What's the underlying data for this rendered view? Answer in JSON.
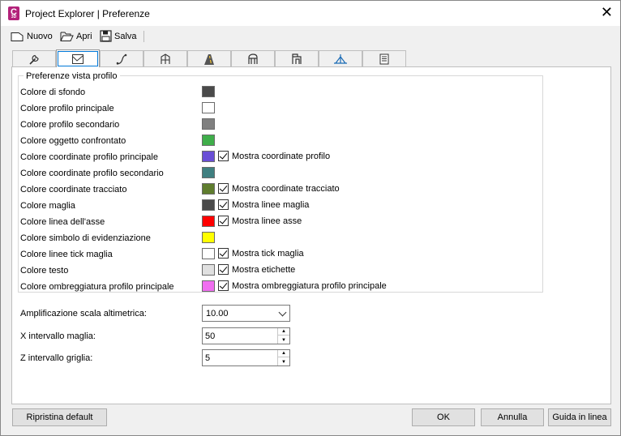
{
  "window": {
    "title": "Project Explorer | Preferenze",
    "app_icon_letter": "C",
    "app_icon_sub": "3D"
  },
  "toolbar": {
    "new_label": "Nuovo",
    "open_label": "Apri",
    "save_label": "Salva"
  },
  "tabs": [
    {
      "icon": "wrench-icon"
    },
    {
      "icon": "profile-view-icon",
      "active": true
    },
    {
      "icon": "alignment-icon"
    },
    {
      "icon": "corridor-icon"
    },
    {
      "icon": "road-icon"
    },
    {
      "icon": "pipe-network-icon"
    },
    {
      "icon": "pressure-network-icon"
    },
    {
      "icon": "survey-icon"
    },
    {
      "icon": "report-icon"
    }
  ],
  "group": {
    "title": "Preferenze vista profilo",
    "rows": [
      {
        "label": "Colore di sfondo",
        "color": "#4a4a4a"
      },
      {
        "label": "Colore profilo principale",
        "color": "#ffffff"
      },
      {
        "label": "Colore profilo secondario",
        "color": "#808080"
      },
      {
        "label": "Colore oggetto confrontato",
        "color": "#3fae4a"
      },
      {
        "label": "Colore coordinate profilo principale",
        "color": "#6a4fd6",
        "check": "Mostra coordinate profilo"
      },
      {
        "label": "Colore coordinate profilo secondario",
        "color": "#3f7f80"
      },
      {
        "label": "Colore coordinate tracciato",
        "color": "#5f7d2e",
        "check": "Mostra coordinate tracciato"
      },
      {
        "label": "Colore maglia",
        "color": "#4a4a4a",
        "check": "Mostra linee maglia"
      },
      {
        "label": "Colore linea dell'asse",
        "color": "#ff0000",
        "check": "Mostra linee asse"
      },
      {
        "label": "Colore simbolo di evidenziazione",
        "color": "#ffff00"
      },
      {
        "label": "Colore linee tick maglia",
        "color": "#ffffff",
        "check": "Mostra tick maglia"
      },
      {
        "label": "Colore testo",
        "color": "#e0e0e0",
        "check": "Mostra etichette"
      },
      {
        "label": "Colore ombreggiatura profilo principale",
        "color": "#f06ef0",
        "check": "Mostra ombreggiatura profilo principale"
      }
    ]
  },
  "fields": {
    "scale_label": "Amplificazione scala altimetrica:",
    "scale_value": "10.00",
    "x_label": "X intervallo maglia:",
    "x_value": "50",
    "z_label": "Z intervallo griglia:",
    "z_value": "5"
  },
  "buttons": {
    "reset": "Ripristina default",
    "ok": "OK",
    "cancel": "Annulla",
    "help": "Guida in linea"
  }
}
